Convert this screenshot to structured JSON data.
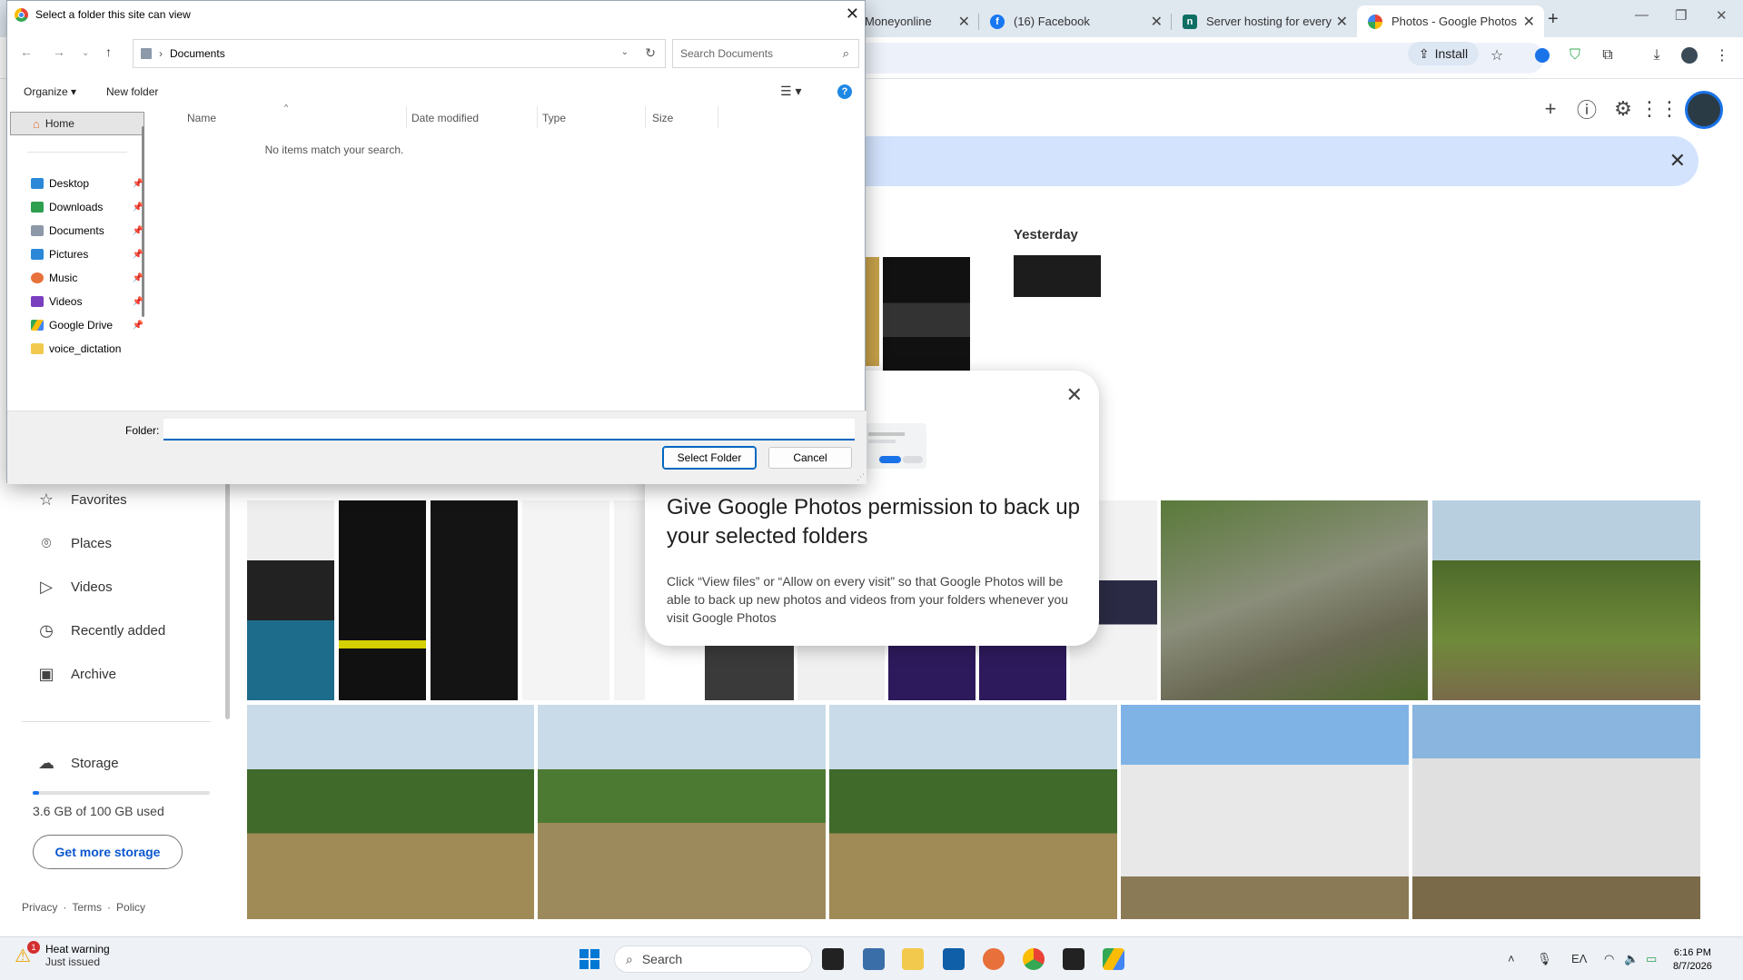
{
  "browser": {
    "tabs": [
      {
        "title": "Moneyonline"
      },
      {
        "title": "(16) Facebook"
      },
      {
        "title": "Server hosting for every n"
      },
      {
        "title": "Photos - Google Photos"
      }
    ],
    "install_label": "Install"
  },
  "photos": {
    "section_yesterday": "Yesterday",
    "nav": [
      {
        "label": "Favorites",
        "icon": "star-icon"
      },
      {
        "label": "Places",
        "icon": "place-icon"
      },
      {
        "label": "Videos",
        "icon": "play-icon"
      },
      {
        "label": "Recently added",
        "icon": "clock-icon"
      },
      {
        "label": "Archive",
        "icon": "archive-icon"
      },
      {
        "label": "Storage",
        "icon": "cloud-icon"
      }
    ],
    "storage": {
      "used_text": "3.6 GB of 100 GB used",
      "fraction": 0.036,
      "button": "Get more storage"
    },
    "footer": [
      "Privacy",
      "·",
      "Terms",
      "·",
      "Policy"
    ]
  },
  "permission_dialog": {
    "title": "Give Google Photos permission to back up your selected folders",
    "body": "Click “View files” or “Allow on every visit” so that Google Photos will be able to back up new photos and videos from your folders whenever you visit Google Photos"
  },
  "file_dialog": {
    "title": "Select a folder this site can view",
    "address": "Documents",
    "search_placeholder": "Search Documents",
    "organize_label": "Organize ▾",
    "new_folder_label": "New folder",
    "home_label": "Home",
    "quick_access": [
      {
        "label": "Desktop",
        "color": "#2b88d8"
      },
      {
        "label": "Downloads",
        "color": "#2e9e4f"
      },
      {
        "label": "Documents",
        "color": "#8d98a8"
      },
      {
        "label": "Pictures",
        "color": "#2b88d8"
      },
      {
        "label": "Music",
        "color": "#e8703a"
      },
      {
        "label": "Videos",
        "color": "#7a3fbf"
      },
      {
        "label": "Google Drive",
        "color": "#34a853"
      },
      {
        "label": "voice_dictation",
        "color": "#f2c94c"
      }
    ],
    "columns": [
      "Name",
      "Date modified",
      "Type",
      "Size"
    ],
    "empty_message": "No items match your search.",
    "folder_label": "Folder:",
    "folder_value": "",
    "select_button": "Select Folder",
    "cancel_button": "Cancel"
  },
  "taskbar": {
    "notification_title": "Heat warning",
    "notification_sub": "Just issued",
    "notification_count": "1",
    "search_placeholder": "Search",
    "lang": "ΕΛ",
    "time": "6:16 PM",
    "date": "8/7/2026"
  }
}
